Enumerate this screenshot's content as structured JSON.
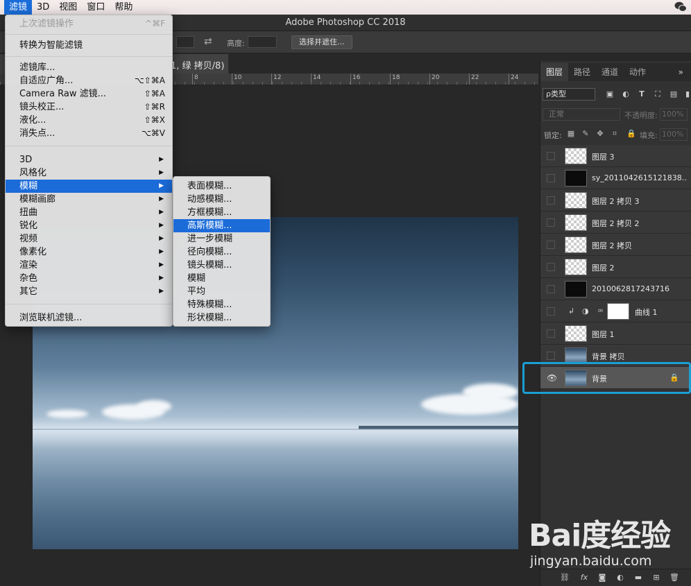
{
  "menubar": {
    "items": [
      "滤镜",
      "3D",
      "视图",
      "窗口",
      "帮助"
    ],
    "active": "滤镜"
  },
  "window": {
    "title": "Adobe Photoshop CC 2018"
  },
  "options_bar": {
    "height_label": "高度:",
    "select_mask_button": "选择并遮住..."
  },
  "doc_tab": {
    "title_fragment": "1, 绿 拷贝/8)"
  },
  "ruler": {
    "labels": [
      "8",
      "10",
      "12",
      "14",
      "16",
      "18",
      "20",
      "22",
      "24"
    ]
  },
  "filter_menu": {
    "last_filter": "上次滤镜操作",
    "last_filter_shortcut": "^⌘F",
    "convert_smart": "转换为智能滤镜",
    "gallery": "滤镜库...",
    "adaptive_wide": "自适应广角...",
    "adaptive_wide_sc": "⌥⇧⌘A",
    "camera_raw": "Camera Raw 滤镜...",
    "camera_raw_sc": "⇧⌘A",
    "lens_correction": "镜头校正...",
    "lens_correction_sc": "⇧⌘R",
    "liquify": "液化...",
    "liquify_sc": "⇧⌘X",
    "vanishing_point": "消失点...",
    "vanishing_point_sc": "⌥⌘V",
    "submenus": [
      "3D",
      "风格化",
      "模糊",
      "模糊画廊",
      "扭曲",
      "锐化",
      "视频",
      "像素化",
      "渲染",
      "杂色",
      "其它"
    ],
    "browse_online": "浏览联机滤镜..."
  },
  "blur_menu": {
    "items": [
      "表面模糊...",
      "动感模糊...",
      "方框模糊...",
      "高斯模糊...",
      "进一步模糊",
      "径向模糊...",
      "镜头模糊...",
      "模糊",
      "平均",
      "特殊模糊...",
      "形状模糊..."
    ],
    "highlighted": "高斯模糊..."
  },
  "layers_panel": {
    "tabs": [
      "图层",
      "路径",
      "通道",
      "动作"
    ],
    "more": "»",
    "filter_type": "ρ类型",
    "blend_mode": "正常",
    "opacity_label": "不透明度:",
    "opacity_value": "100%",
    "lock_label": "锁定:",
    "fill_label": "填充:",
    "fill_value": "100%",
    "layers": [
      {
        "name": "图层 3",
        "visible": false,
        "thumb": "transparent"
      },
      {
        "name": "sy_2011042615121838...",
        "visible": false,
        "thumb": "dark"
      },
      {
        "name": "图层 2 拷贝 3",
        "visible": false,
        "thumb": "transparent"
      },
      {
        "name": "图层 2 拷贝 2",
        "visible": false,
        "thumb": "transparent"
      },
      {
        "name": "图层 2 拷贝",
        "visible": false,
        "thumb": "transparent"
      },
      {
        "name": "图层 2",
        "visible": false,
        "thumb": "transparent"
      },
      {
        "name": "2010062817243716",
        "visible": false,
        "thumb": "dark"
      },
      {
        "name": "曲线 1",
        "visible": false,
        "thumb": "adjustment"
      },
      {
        "name": "图层 1",
        "visible": false,
        "thumb": "transparent"
      },
      {
        "name": "背景 拷贝",
        "visible": false,
        "thumb": "photo"
      },
      {
        "name": "背景",
        "visible": true,
        "thumb": "photo",
        "locked": true,
        "selected": true
      }
    ]
  },
  "watermark": {
    "logo": "Bai度经验",
    "url": "jingyan.baidu.com"
  }
}
